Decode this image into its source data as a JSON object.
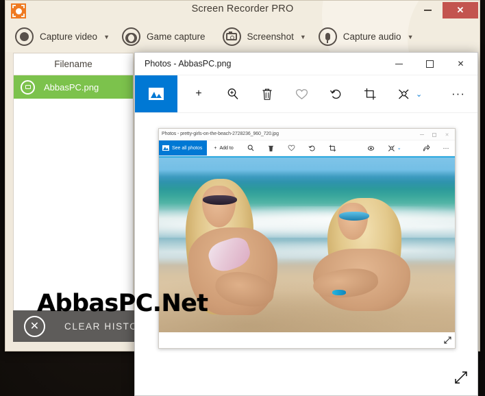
{
  "recorder": {
    "title": "Screen Recorder PRO",
    "logo_icon": "orange-capture-logo-icon",
    "window_controls": {
      "minimize": "minimize-icon",
      "close": "✕"
    },
    "toolbar": [
      {
        "label": "Capture video",
        "icon": "record-circle-icon",
        "caret": "▼"
      },
      {
        "label": "Game capture",
        "icon": "gamepad-icon",
        "caret": ""
      },
      {
        "label": "Screenshot",
        "icon": "camera-icon",
        "caret": "▼"
      },
      {
        "label": "Capture audio",
        "icon": "microphone-icon",
        "caret": "▼"
      }
    ],
    "file_list": {
      "header": "Filename",
      "rows": [
        {
          "name": "AbbasPC.png",
          "icon": "camera-circle-icon",
          "selected": true
        }
      ]
    },
    "clear_history": {
      "label": "CLEAR HISTORY",
      "icon": "close-circle-icon"
    }
  },
  "photos_window": {
    "title": "Photos - AbbasPC.png",
    "window_controls": {
      "minimize": "minimize-icon",
      "maximize": "maximize-icon",
      "close": "✕"
    },
    "toolbar": [
      {
        "name": "see-all-photos",
        "icon": "picture-icon",
        "glyph": ""
      },
      {
        "name": "add-to",
        "icon": "plus-icon",
        "glyph": "+"
      },
      {
        "name": "zoom",
        "icon": "zoom-in-icon",
        "glyph": "⌕"
      },
      {
        "name": "delete",
        "icon": "trash-icon",
        "glyph": "🗑"
      },
      {
        "name": "favorite",
        "icon": "heart-icon",
        "glyph": "♡"
      },
      {
        "name": "rotate",
        "icon": "rotate-icon",
        "glyph": "↻"
      },
      {
        "name": "crop",
        "icon": "crop-icon",
        "glyph": "⌗"
      },
      {
        "name": "enhance",
        "icon": "enhance-icon",
        "glyph": "✄"
      },
      {
        "name": "enhance-chevron",
        "icon": "chevron-down-icon",
        "glyph": "⌄"
      },
      {
        "name": "see-more",
        "icon": "ellipsis-icon",
        "glyph": "···"
      }
    ],
    "resize_handle": "resize-diagonal-icon"
  },
  "inner_screenshot": {
    "title": "Photos - pretty-girls-on-the-beach-2728236_960_720.jpg",
    "window_controls": {
      "minimize": "minimize-icon",
      "maximize": "maximize-icon",
      "close": "✕"
    },
    "toolbar": {
      "see_all_photos": "See all photos",
      "add_to": "Add to",
      "icons": [
        {
          "name": "zoom",
          "icon": "zoom-in-icon",
          "glyph": "⌕"
        },
        {
          "name": "delete",
          "icon": "trash-icon",
          "glyph": "🗑"
        },
        {
          "name": "favorite",
          "icon": "heart-icon",
          "glyph": "♡"
        },
        {
          "name": "rotate",
          "icon": "rotate-icon",
          "glyph": "↻"
        },
        {
          "name": "crop",
          "icon": "crop-icon",
          "glyph": "⌗"
        },
        {
          "name": "red-eye",
          "icon": "red-eye-icon",
          "glyph": "◉"
        },
        {
          "name": "enhance",
          "icon": "enhance-icon",
          "glyph": "✄"
        },
        {
          "name": "enhance-chevron",
          "icon": "chevron-down-icon",
          "glyph": "⌄"
        },
        {
          "name": "share",
          "icon": "share-icon",
          "glyph": "↗"
        },
        {
          "name": "see-more",
          "icon": "ellipsis-icon",
          "glyph": "···"
        }
      ]
    },
    "photo_alt": "two-women-on-beach-photo",
    "resize_handle": "resize-diagonal-icon"
  },
  "watermark": {
    "text": "AbbasPC.Net"
  },
  "colors": {
    "recorder_chrome": "#f2ecdf",
    "close_red": "#c3544f",
    "selected_row_green": "#7cc24c",
    "clear_bar_gray": "#5e5c5a",
    "photos_accent_blue": "#0078d4",
    "logo_orange": "#ef7a21"
  }
}
